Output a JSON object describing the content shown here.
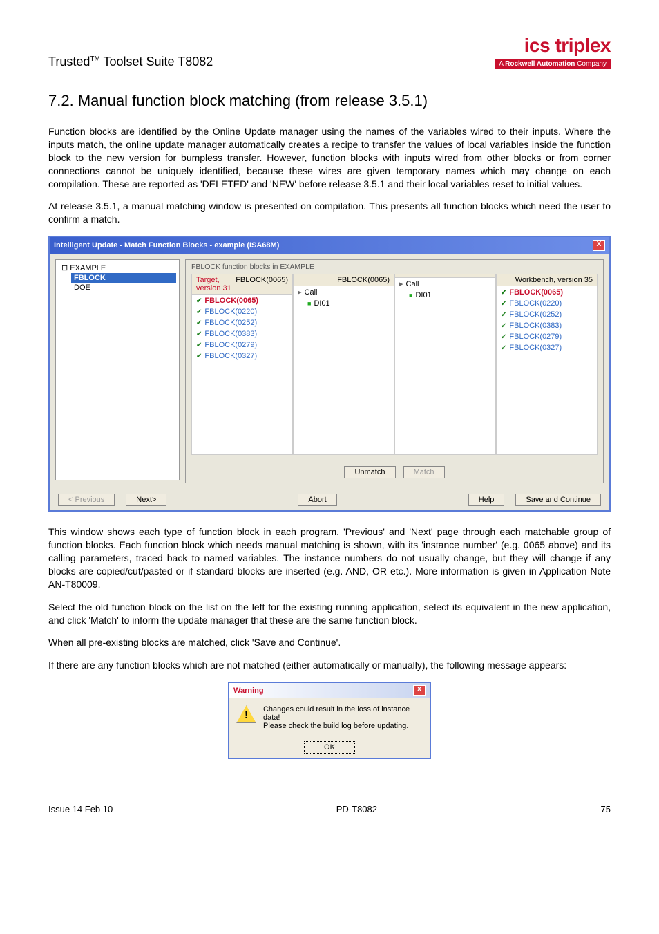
{
  "header": {
    "product": "Trusted",
    "tm": "TM",
    "suffix": " Toolset Suite T8082",
    "logo_top": "ics triplex",
    "logo_sub_prefix": "A ",
    "logo_sub_bold": "Rockwell Automation",
    "logo_sub_suffix": " Company"
  },
  "section": {
    "number": "7.2.",
    "title": "Manual function block matching (from release 3.5.1)"
  },
  "paragraphs": {
    "p1": "Function blocks are identified by the Online Update manager using the names of the variables wired to their inputs. Where the inputs match, the online update manager automatically creates a recipe to transfer the values of local variables inside the function block to the new version for bumpless transfer. However, function blocks with inputs wired from other blocks or from corner connections cannot be uniquely identified, because these wires are given temporary names which may change on each compilation. These are reported as 'DELETED' and 'NEW' before release 3.5.1 and their local variables reset to initial values.",
    "p2": "At release 3.5.1, a manual matching window is presented on compilation. This presents all function blocks which need the user to confirm a match.",
    "p3": "This window shows each type of function block in each program. 'Previous' and 'Next' page through each matchable group of function blocks. Each function block which needs manual matching is shown, with its 'instance number' (e.g. 0065 above) and its calling parameters, traced back to named variables. The instance numbers do not usually change, but they will change if any blocks are copied/cut/pasted or if standard blocks are inserted (e.g. AND, OR etc.). More information is given in Application Note AN-T80009.",
    "p4": "Select the old function block on the list on the left for the existing running application, select its equivalent in the new application, and click 'Match' to inform the update manager that these are the same function block.",
    "p5": "When all pre-existing blocks are matched, click 'Save and Continue'.",
    "p6": "If there are any function blocks which are not matched (either automatically or manually), the following message appears:"
  },
  "dialog": {
    "title": "Intelligent Update - Match Function Blocks - example (ISA68M)",
    "tree": {
      "root": "EXAMPLE",
      "items": [
        "FBLOCK",
        "DOE"
      ],
      "selected_index": 0
    },
    "content_title": "FBLOCK function blocks in EXAMPLE",
    "left_col": {
      "head_left": "Target, version 31",
      "head_right": "FBLOCK(0065)",
      "selected": "FBLOCK(0065)",
      "items": [
        "FBLOCK(0220)",
        "FBLOCK(0252)",
        "FBLOCK(0383)",
        "FBLOCK(0279)",
        "FBLOCK(0327)"
      ]
    },
    "mid_col": {
      "head_left": "",
      "head_right": "FBLOCK(0065)",
      "call": "Call",
      "var": "DI01"
    },
    "mid2_col": {
      "call": "Call",
      "var": "DI01"
    },
    "right_col": {
      "head_left": "Workbench, version 35",
      "selected": "FBLOCK(0065)",
      "items": [
        "FBLOCK(0220)",
        "FBLOCK(0252)",
        "FBLOCK(0383)",
        "FBLOCK(0279)",
        "FBLOCK(0327)"
      ]
    },
    "buttons": {
      "unmatch": "Unmatch",
      "match": "Match",
      "previous": "< Previous",
      "next": "Next>",
      "abort": "Abort",
      "help": "Help",
      "save": "Save and Continue"
    }
  },
  "warning": {
    "title": "Warning",
    "line1": "Changes could result in the loss of instance data!",
    "line2": "Please check the build log before updating.",
    "ok": "OK"
  },
  "footer": {
    "left": "Issue 14 Feb 10",
    "mid": "PD-T8082",
    "right": "75"
  }
}
